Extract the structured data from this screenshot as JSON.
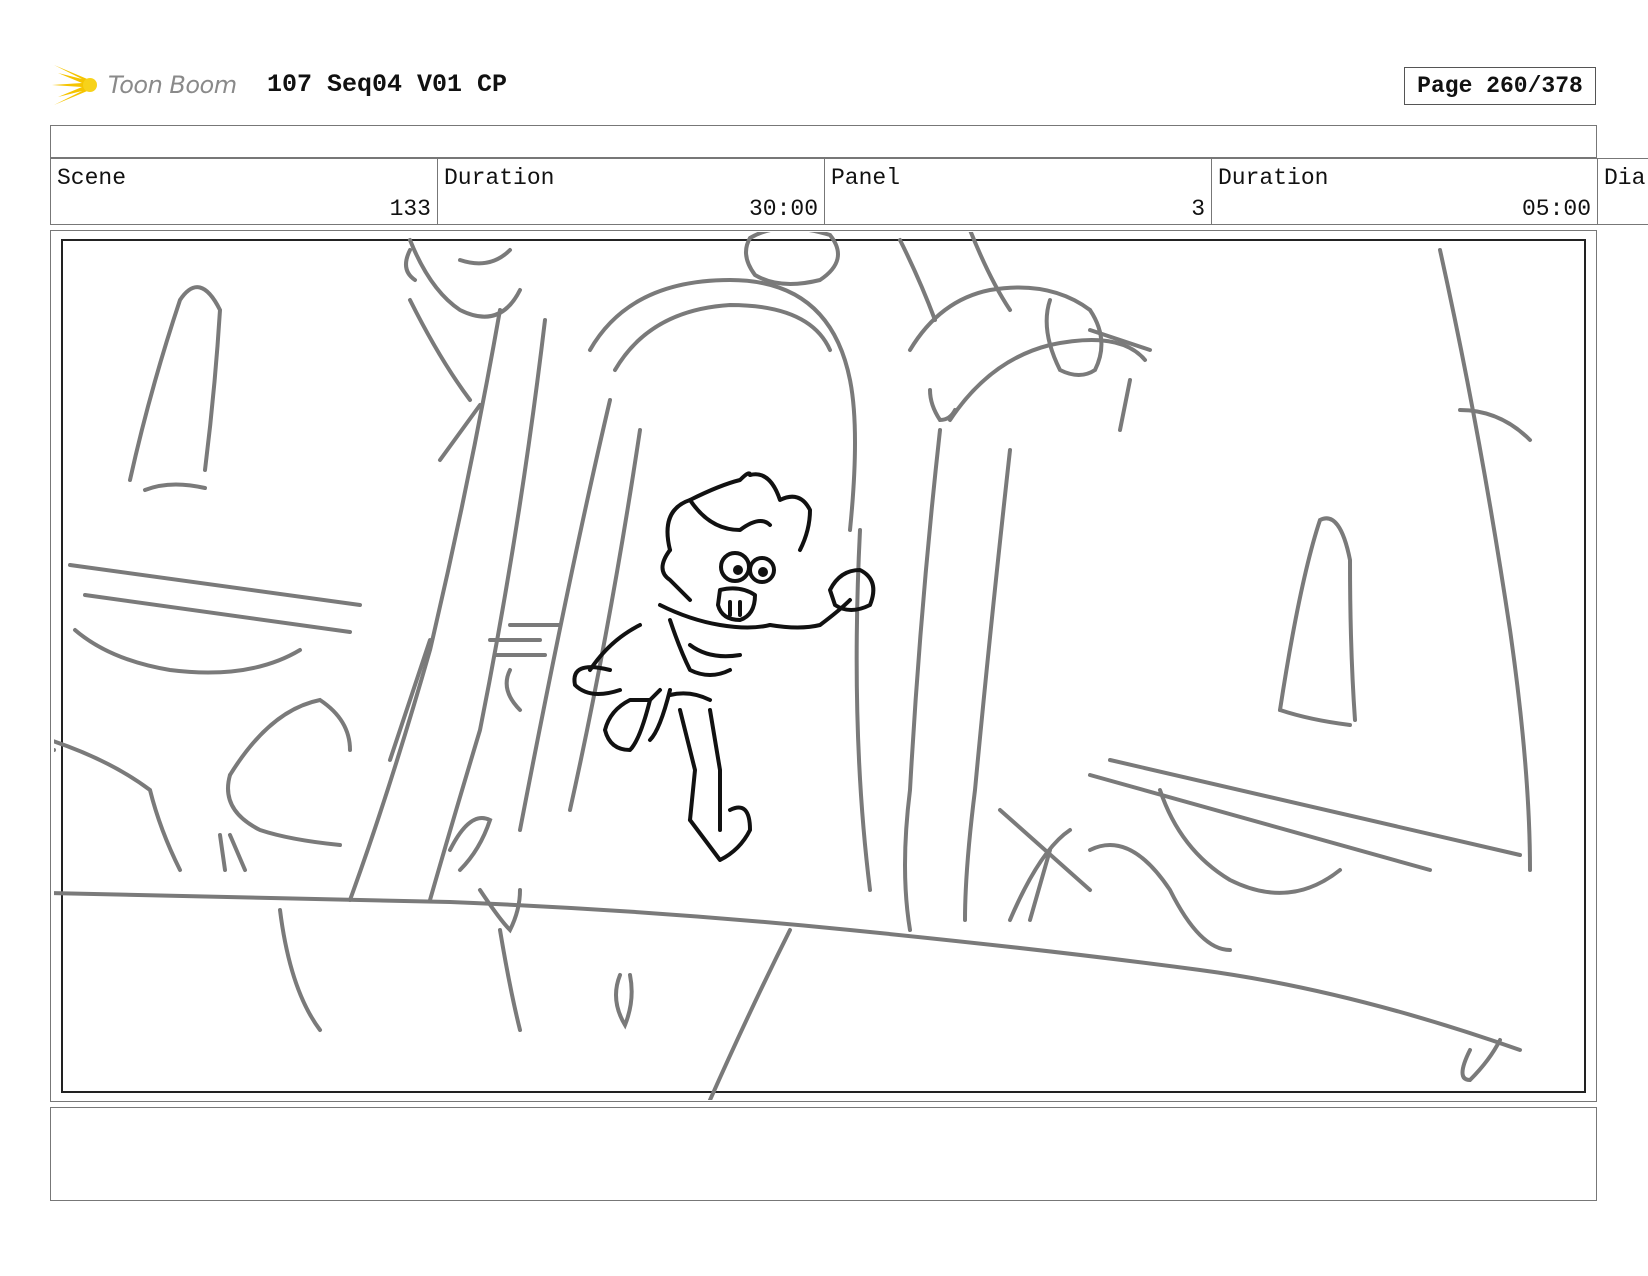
{
  "header": {
    "logo_text": "Toon Boom",
    "title": "107 Seq04 V01 CP",
    "page": "Page 260/378"
  },
  "info": {
    "scene_label": "Scene",
    "scene_value": "133",
    "scene_duration_label": "Duration",
    "scene_duration_value": "30:00",
    "panel_label": "Panel",
    "panel_value": "3",
    "panel_duration_label": "Duration",
    "panel_duration_value": "05:00",
    "dialog_label": "Dia"
  },
  "panel": {
    "image_icon": "storyboard-sketch"
  },
  "colors": {
    "logo_yellow": "#f5c400",
    "sketch_gray": "#7a7a7a",
    "ink": "#111111"
  }
}
